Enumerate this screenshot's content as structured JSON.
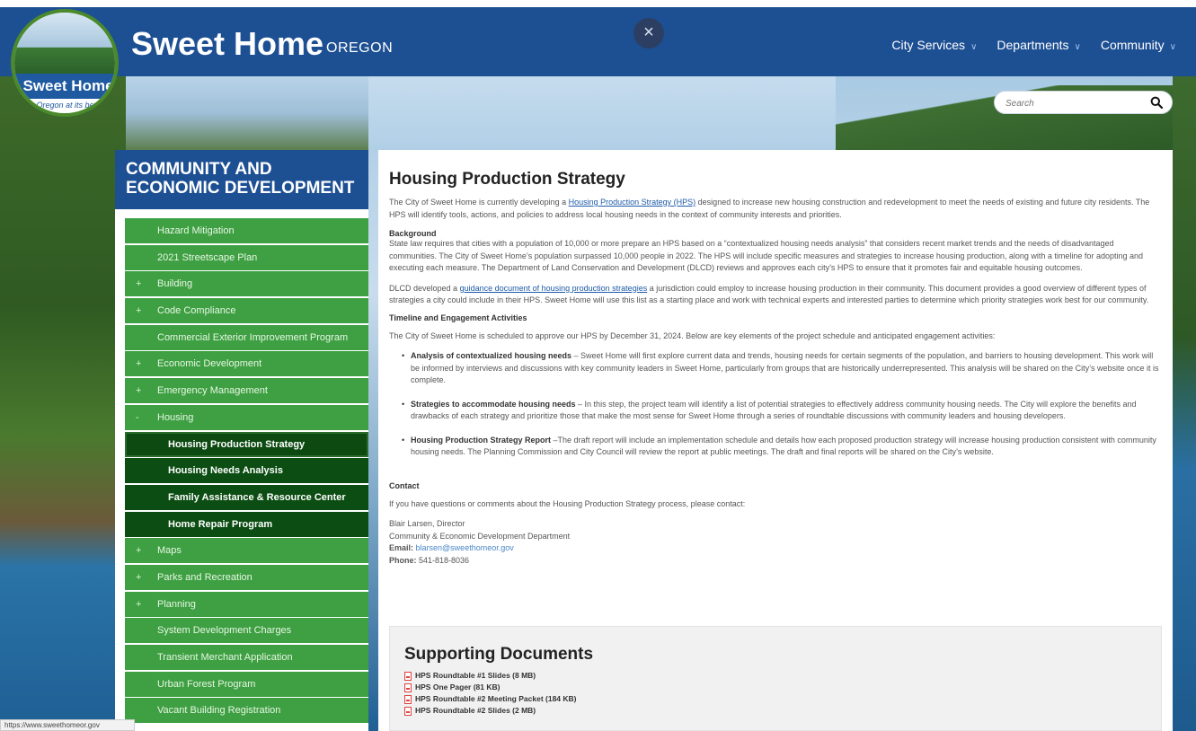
{
  "header": {
    "logo_text": "Sweet Home",
    "logo_tagline": "Oregon at its best",
    "site_title": "Sweet Home",
    "site_subtitle": "OREGON",
    "close_symbol": "×",
    "nav": [
      "City Services",
      "Departments",
      "Community"
    ]
  },
  "search": {
    "placeholder": "Search"
  },
  "sidebar": {
    "heading": "COMMUNITY AND ECONOMIC DEVELOPMENT",
    "items": [
      {
        "label": "Hazard Mitigation",
        "plus": ""
      },
      {
        "label": "2021 Streetscape Plan",
        "plus": ""
      },
      {
        "label": "Building",
        "plus": "+"
      },
      {
        "label": "Code Compliance",
        "plus": "+"
      },
      {
        "label": "Commercial Exterior Improvement Program",
        "plus": ""
      },
      {
        "label": "Economic Development",
        "plus": "+"
      },
      {
        "label": "Emergency Management",
        "plus": "+"
      },
      {
        "label": "Housing",
        "plus": "-"
      },
      {
        "label": "Housing Production Strategy",
        "plus": ""
      },
      {
        "label": "Housing Needs Analysis",
        "plus": ""
      },
      {
        "label": "Family Assistance & Resource Center",
        "plus": ""
      },
      {
        "label": "Home Repair Program",
        "plus": ""
      },
      {
        "label": "Maps",
        "plus": "+"
      },
      {
        "label": "Parks and Recreation",
        "plus": "+"
      },
      {
        "label": "Planning",
        "plus": "+"
      },
      {
        "label": "System Development Charges",
        "plus": ""
      },
      {
        "label": "Transient Merchant Application",
        "plus": ""
      },
      {
        "label": "Urban Forest Program",
        "plus": ""
      },
      {
        "label": "Vacant Building Registration",
        "plus": ""
      }
    ]
  },
  "main": {
    "title": "Housing Production Strategy",
    "intro_pre": "The City of Sweet Home is currently developing a ",
    "intro_link": "Housing Production Strategy (HPS)",
    "intro_post": " designed to increase new housing construction and redevelopment to meet the needs of existing and future city residents. The HPS will identify tools, actions, and policies to address local housing needs in the context of community interests and priorities.",
    "background_heading": "Background",
    "background_text": "State law requires that cities with a population of 10,000 or more prepare an HPS based on a “contextualized housing needs analysis” that considers recent market trends and the needs of disadvantaged communities. The City of Sweet Home’s population surpassed 10,000 people in 2022. The HPS will include specific measures and strategies to increase housing production, along with a timeline for adopting and executing each measure. The Department of Land Conservation and Development (DLCD) reviews and approves each city’s HPS to ensure that it promotes fair and equitable housing outcomes.",
    "dlcd_pre": "DLCD developed a ",
    "dlcd_link": "guidance document of housing production strategies",
    "dlcd_post": " a jurisdiction could employ to increase housing production in their community. This document provides a good overview of different types of strategies a city could include in their HPS. Sweet Home will use this list as a starting place and work with technical experts and interested parties to determine which priority strategies work best for our community.",
    "timeline_heading": "Timeline and Engagement Activities",
    "timeline_text": "The City of Sweet Home is scheduled to approve our HPS by December 31, 2024. Below are key elements of the project schedule and anticipated engagement activities:",
    "bullets": [
      {
        "bold": "Analysis of contextualized housing needs",
        "text": " – Sweet Home will first explore current data and trends, housing needs for certain segments of the population, and barriers to housing development. This work will be informed by interviews and discussions with key community leaders in Sweet Home, particularly from groups that are historically underrepresented. This analysis will be shared on the City’s website once it is complete."
      },
      {
        "bold": "Strategies to accommodate housing needs",
        "text": " – In this step, the project team will identify a list of potential strategies to effectively address community housing needs. The City will explore the benefits and drawbacks of each strategy and prioritize those that make the most sense for Sweet Home through a series of roundtable discussions with community leaders and housing developers."
      },
      {
        "bold": "Housing Production Strategy Report",
        "text": " –The draft report will include an implementation schedule and details how each proposed production strategy will increase housing production consistent with community housing needs. The Planning Commission and City Council will review the report at public meetings. The draft and final reports will be shared on the City’s website."
      }
    ],
    "contact_heading": "Contact",
    "contact_text": "If you have questions or comments about the Housing Production Strategy process, please contact:",
    "contact_name": "Blair Larsen, Director",
    "contact_dept": "Community & Economic Development Department",
    "email_label": "Email:",
    "email": "blarsen@sweethomeor.gov",
    "phone_label": "Phone:",
    "phone": "541-818-8036"
  },
  "documents": {
    "heading": "Supporting Documents",
    "items": [
      "HPS Roundtable #1 Slides (8 MB)",
      "HPS One Pager (81 KB)",
      "HPS Roundtable #2 Meeting Packet (184 KB)",
      "HPS Roundtable #2 Slides (2 MB)"
    ]
  },
  "status_bar": "https://www.sweethomeor.gov"
}
